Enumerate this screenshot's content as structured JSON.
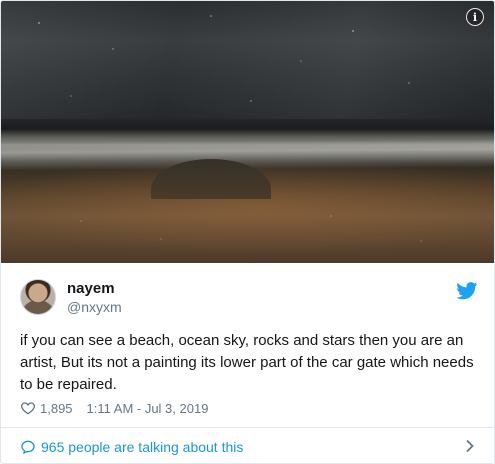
{
  "tweet": {
    "user": {
      "name": "nayem",
      "handle": "@nxyxm"
    },
    "text": "if you can see a beach, ocean sky, rocks and stars then you are an artist, But its not a painting its lower part of the car gate which needs to be repaired.",
    "likes": "1,895",
    "timestamp": "1:11 AM - Jul 3, 2019",
    "discussion_link": "965 people are talking about this"
  },
  "icons": {
    "info": "info-icon",
    "platform": "twitter-bird-icon",
    "like": "heart-icon",
    "discussion": "speech-bubble-icon",
    "more": "chevron-right-icon"
  },
  "colors": {
    "accent": "#1da1f2",
    "link": "#1b95e0",
    "secondary_text": "#657786",
    "border": "#e1e8ed"
  }
}
